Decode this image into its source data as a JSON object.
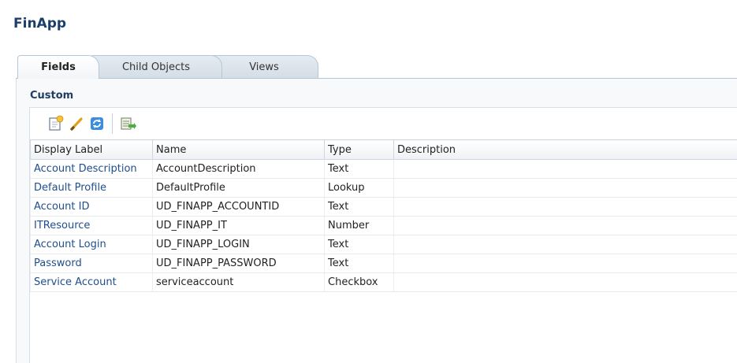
{
  "app": {
    "title": "FinApp"
  },
  "tabs": [
    {
      "label": "Fields"
    },
    {
      "label": "Child Objects"
    },
    {
      "label": "Views"
    }
  ],
  "section": {
    "title": "Custom"
  },
  "toolbar": {
    "icons": [
      "create-icon",
      "edit-icon",
      "refresh-icon",
      "export-icon"
    ]
  },
  "table": {
    "headers": [
      "Display Label",
      "Name",
      "Type",
      "Description"
    ],
    "rows": [
      {
        "label": "Account Description",
        "name": "AccountDescription",
        "type": "Text",
        "description": ""
      },
      {
        "label": "Default Profile",
        "name": "DefaultProfile",
        "type": "Lookup",
        "description": ""
      },
      {
        "label": "Account ID",
        "name": "UD_FINAPP_ACCOUNTID",
        "type": "Text",
        "description": ""
      },
      {
        "label": "ITResource",
        "name": "UD_FINAPP_IT",
        "type": "Number",
        "description": ""
      },
      {
        "label": "Account Login",
        "name": "UD_FINAPP_LOGIN",
        "type": "Text",
        "description": ""
      },
      {
        "label": "Password",
        "name": "UD_FINAPP_PASSWORD",
        "type": "Text",
        "description": ""
      },
      {
        "label": "Service Account",
        "name": "serviceaccount",
        "type": "Checkbox",
        "description": ""
      }
    ]
  },
  "colors": {
    "title": "#1a3f6b",
    "link": "#1f4e8c"
  }
}
